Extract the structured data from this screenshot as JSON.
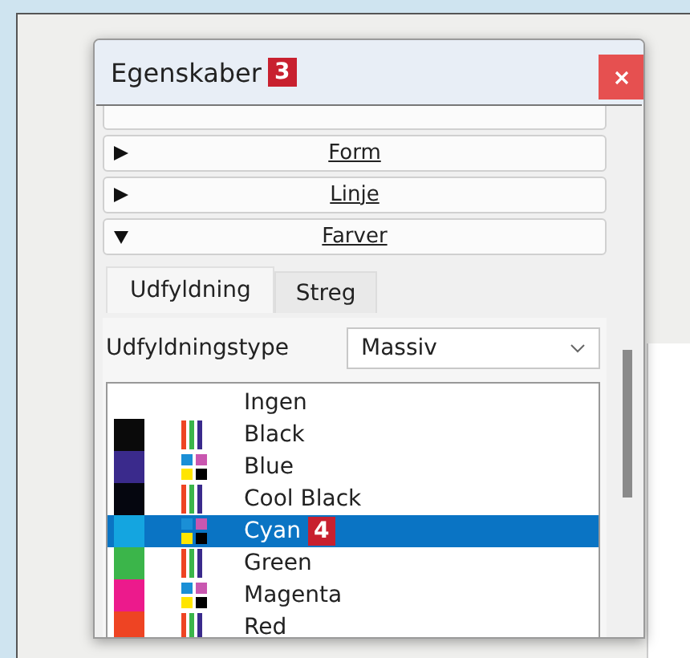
{
  "dialog": {
    "title": "Egenskaber",
    "callout": "3"
  },
  "sections": [
    {
      "label": "Form",
      "expanded": false
    },
    {
      "label": "Linje",
      "expanded": false
    },
    {
      "label": "Farver",
      "expanded": true
    }
  ],
  "tabs": [
    {
      "label": "Udfyldning",
      "selected": true
    },
    {
      "label": "Streg",
      "selected": false
    }
  ],
  "fill_type": {
    "label": "Udfyldningstype",
    "value": "Massiv"
  },
  "colors": [
    {
      "name": "Ingen",
      "selected": false
    },
    {
      "name": "Black",
      "color": "#0a0a0a",
      "selected": false
    },
    {
      "name": "Blue",
      "color": "#3a2a8c",
      "selected": false
    },
    {
      "name": "Cool Black",
      "color": "#05060f",
      "selected": false
    },
    {
      "name": "Cyan",
      "color": "#14a5e0",
      "selected": true,
      "callout": "4"
    },
    {
      "name": "Green",
      "color": "#3bb54a",
      "selected": false
    },
    {
      "name": "Magenta",
      "color": "#ec1a8c",
      "selected": false
    },
    {
      "name": "Red",
      "color": "#ee4423",
      "selected": false
    }
  ]
}
